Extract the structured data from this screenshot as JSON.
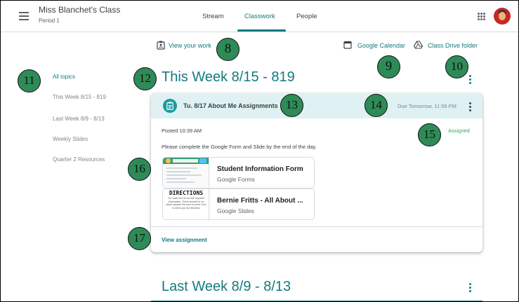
{
  "header": {
    "class_name": "Miss Blanchet's Class",
    "period": "Period 1",
    "tabs": [
      {
        "label": "Stream"
      },
      {
        "label": "Classwork"
      },
      {
        "label": "People"
      }
    ]
  },
  "top_links": {
    "view_work": "View your work",
    "calendar": "Google Calendar",
    "drive": "Class Drive folder"
  },
  "sidebar": {
    "items": [
      {
        "label": "All topics"
      },
      {
        "label": "This Week 8/15 - 819"
      },
      {
        "label": "Last Week 8/9 - 8/13"
      },
      {
        "label": "Weekly Slides"
      },
      {
        "label": "Quarter 2 Resources"
      }
    ]
  },
  "topics": [
    {
      "title": "This Week 8/15 - 819"
    },
    {
      "title": "Last Week 8/9 - 8/13"
    }
  ],
  "assignment": {
    "title": "Tu. 8/17 About Me Assignments",
    "due": "Due Tomorrow, 11:59 PM",
    "posted": "Posted 10:39 AM",
    "status": "Assigned",
    "instructions": "Please complete the Google Form and Slide by the end of the day.",
    "view_label": "View assignment",
    "attachments": [
      {
        "title": "Student Information Form",
        "type": "Google Forms"
      },
      {
        "title": "Bernie Fritts - All About ...",
        "type": "Google Slides",
        "thumb_heading": "DIRECTIONS",
        "thumb_text": "For each box fill out the required information. There should be no blank spaces! Be sure to press Turn In when you are finished."
      }
    ]
  },
  "callouts": [
    "8",
    "9",
    "10",
    "11",
    "12",
    "13",
    "14",
    "15",
    "16",
    "17"
  ],
  "colors": {
    "accent": "#137a7f",
    "card_header": "#dff1f2",
    "assigned": "#34a853",
    "callout": "#2e8b57"
  },
  "icons": [
    "menu-icon",
    "badge-icon",
    "calendar-icon",
    "drive-icon",
    "apps-icon",
    "kebab-icon",
    "assignment-icon"
  ]
}
